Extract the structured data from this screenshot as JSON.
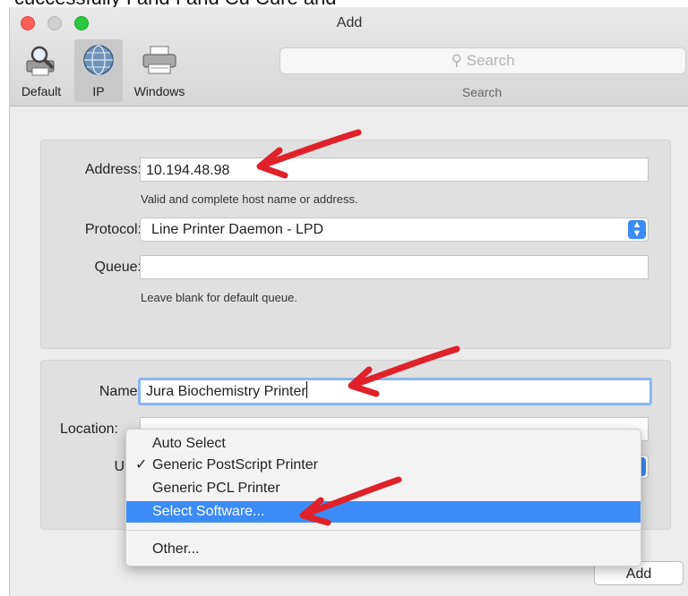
{
  "window": {
    "title": "Add"
  },
  "toolbar": {
    "items": [
      {
        "label": "Default"
      },
      {
        "label": "IP"
      },
      {
        "label": "Windows"
      }
    ],
    "search_placeholder": "Search",
    "search_caption": "Search"
  },
  "ip_section": {
    "address_label": "Address:",
    "address_value": "10.194.48.98",
    "address_hint": "Valid and complete host name or address.",
    "protocol_label": "Protocol:",
    "protocol_value": "Line Printer Daemon - LPD",
    "queue_label": "Queue:",
    "queue_value": "",
    "queue_hint": "Leave blank for default queue."
  },
  "printer_section": {
    "name_label": "Name:",
    "name_value": "Jura Biochemistry Printer",
    "location_label": "Location:",
    "use_label": "Use"
  },
  "use_menu": {
    "items": [
      {
        "label": "Auto Select",
        "checked": false
      },
      {
        "label": "Generic PostScript Printer",
        "checked": true
      },
      {
        "label": "Generic PCL Printer",
        "checked": false
      },
      {
        "label": "Select Software...",
        "highlighted": true
      },
      {
        "label": "Other..."
      }
    ],
    "checkmark": "✓"
  },
  "buttons": {
    "add": "Add"
  },
  "colors": {
    "accent": "#3b8cf6",
    "annotation": "#e0212a"
  }
}
